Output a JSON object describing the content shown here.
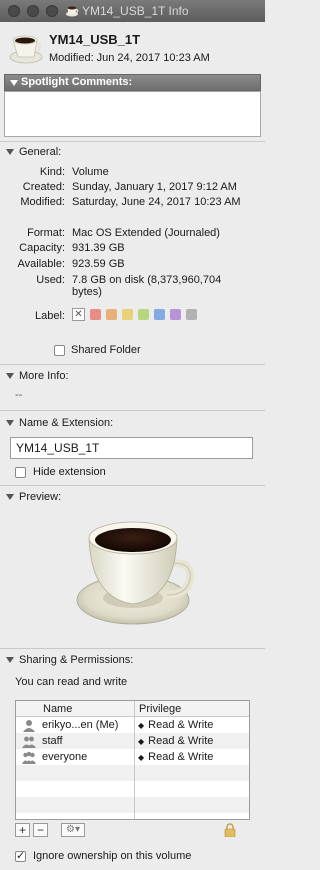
{
  "window": {
    "title": "YM14_USB_1T Info"
  },
  "header": {
    "name": "YM14_USB_1T",
    "modified_label": "Modified:",
    "modified_value": "Jun 24, 2017 10:23 AM"
  },
  "spotlight": {
    "label": "Spotlight Comments:"
  },
  "general": {
    "label": "General:",
    "rows": [
      {
        "k": "Kind:",
        "v": "Volume"
      },
      {
        "k": "Created:",
        "v": "Sunday, January 1, 2017 9:12 AM"
      },
      {
        "k": "Modified:",
        "v": "Saturday, June 24, 2017 10:23 AM"
      },
      {
        "k": "Format:",
        "v": "Mac OS Extended (Journaled)"
      },
      {
        "k": "Capacity:",
        "v": "931.39 GB"
      },
      {
        "k": "Available:",
        "v": "923.59 GB"
      },
      {
        "k": "Used:",
        "v": "7.8 GB on disk (8,373,960,704 bytes)"
      }
    ],
    "label_label": "Label:",
    "label_colors": [
      "#e98c86",
      "#eab07a",
      "#e7d27a",
      "#b7d77f",
      "#85a9e3",
      "#b893d6",
      "#b2b2b2"
    ],
    "shared_folder": "Shared Folder"
  },
  "more_info": {
    "label": "More Info:",
    "value": "--"
  },
  "name_ext": {
    "label": "Name & Extension:",
    "value": "YM14_USB_1T",
    "hide_ext": "Hide extension"
  },
  "preview": {
    "label": "Preview:"
  },
  "sharing": {
    "label": "Sharing & Permissions:",
    "status": "You can read and write",
    "col_name": "Name",
    "col_priv": "Privilege",
    "rows": [
      {
        "icon": "user-icon",
        "name": "erikyo...en (Me)",
        "priv": "Read & Write"
      },
      {
        "icon": "group-icon",
        "name": "staff",
        "priv": "Read & Write"
      },
      {
        "icon": "everyone-icon",
        "name": "everyone",
        "priv": "Read & Write"
      }
    ],
    "add": "+",
    "remove": "−",
    "ignore_ownership": "Ignore ownership on this volume"
  }
}
